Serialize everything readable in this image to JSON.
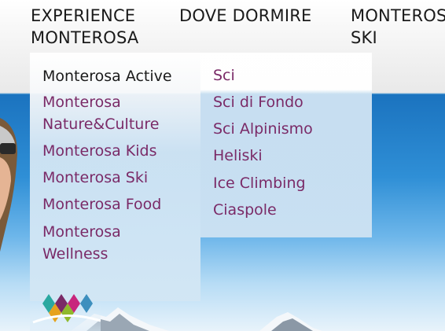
{
  "nav": {
    "experience": "EXPERIENCE\nMONTEROSA",
    "dove_dormire": "DOVE DORMIRE",
    "monterosa_ski": "MONTEROSA\nSKI"
  },
  "submenu_experience": {
    "items": [
      "Monterosa Active",
      "Monterosa\nNature&Culture",
      "Monterosa Kids",
      "Monterosa Ski",
      "Monterosa Food",
      "Monterosa\nWellness"
    ],
    "active_index": 0
  },
  "submenu_active": {
    "items": [
      "Sci",
      "Sci di Fondo",
      "Sci Alpinismo",
      "Heliski",
      "Ice Climbing",
      "Ciaspole"
    ]
  },
  "colors": {
    "link": "#7a2a67",
    "active": "#1a1a1a",
    "logo": [
      "#2aa8a0",
      "#7a2a67",
      "#e6a21c",
      "#8fb92c",
      "#c8267c",
      "#3d8fbe"
    ]
  }
}
